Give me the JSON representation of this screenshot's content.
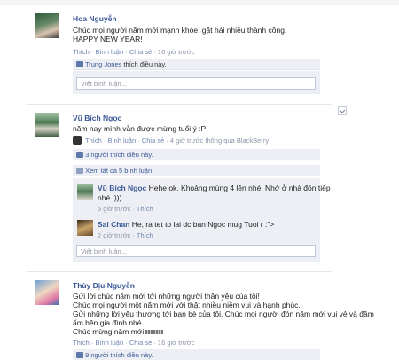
{
  "posts": [
    {
      "name": "Hoa Nguyễn",
      "lines": [
        "Chúc mọi người năm mới mạnh khỏe, gặt hái nhiều thành công.",
        "HAPPY NEW YEAR!"
      ],
      "actions": {
        "like": "Thích",
        "comment": "Bình luận",
        "share": "Chia sẻ",
        "time": "16 giờ trước"
      },
      "likes": {
        "name": "Trung Jones",
        "suffix": "thích điều này."
      },
      "comment_placeholder": "Viết bình luận..."
    },
    {
      "name": "Vũ Bích Ngọc",
      "lines": [
        "năm nay mình vẫn được mừng tuổi ý :P"
      ],
      "actions": {
        "like": "Thích",
        "comment": "Bình luận",
        "share": "Chia sẻ",
        "time": "4 giờ trước thông qua BlackBerry"
      },
      "likes_text": "3 người thích điều này.",
      "view_all": "Xem tất cả 5 bình luận",
      "comments": [
        {
          "name": "Vũ Bích Ngọc",
          "text1": "Hehe ok. Khoảng mùng 4 lên nhé. Nhớ ở nhà đón tiếp",
          "text2": "nhé :)))",
          "time": "5 giờ trước",
          "like": "Thích"
        },
        {
          "name": "Sai Chan",
          "text1": "He, ra tet to lai dc ban Ngoc mug Tuoi r :\">",
          "time": "2 giờ trước",
          "like": "Thích"
        }
      ],
      "comment_placeholder": "Viết bình luận..."
    },
    {
      "name": "Thùy Dịu Nguyễn",
      "lines": [
        "Gửi lời chúc năm mới tới những người thân yêu của tôi!",
        "Chúc mọi người một năm mới với thật nhiều niềm vui và hạnh phúc.",
        "Gửi những lời yêu thương tới bạn bè của tôi. Chúc mọi người đón năm mới vui vẻ và đầm",
        "ấm bên gia đình nhé.",
        "Chúc mừng năm mới"
      ],
      "actions": {
        "like": "Thích",
        "comment": "Bình luận",
        "share": "Chia sẻ",
        "time": "16 giờ trước"
      },
      "likes_text": "9 người thích điều này."
    }
  ],
  "colors": {
    "link": "#3b5998",
    "meta": "#8c95a8",
    "bar": "#edeff4"
  }
}
